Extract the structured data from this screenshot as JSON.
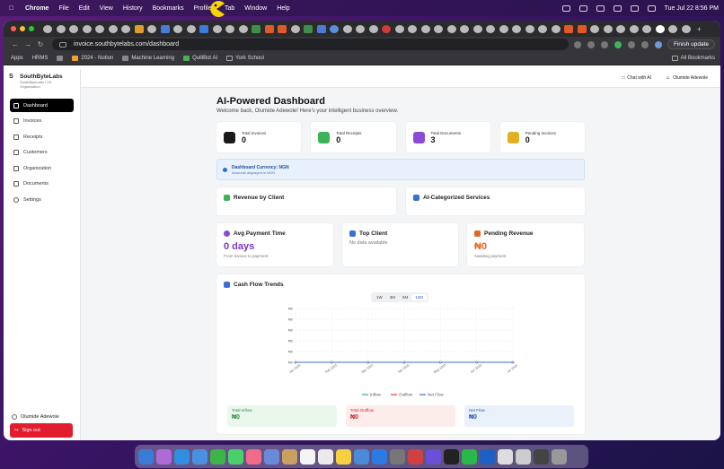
{
  "menubar": {
    "items": [
      "Chrome",
      "File",
      "Edit",
      "View",
      "History",
      "Bookmarks",
      "Profiles",
      "Tab",
      "Window",
      "Help"
    ],
    "clock": "Tue Jul 22  8:56 PM"
  },
  "browser": {
    "url": "invoice.southbytelabs.com/dashboard",
    "update_label": "Finish update",
    "bookmarks": [
      "Apps",
      "HRMS",
      "2024 - Notion",
      "Machine Learning",
      "QuillBot AI",
      "York School"
    ],
    "all_bookmarks": "All Bookmarks"
  },
  "sidebar": {
    "org_initial": "S",
    "org_name": "SouthByteLabs",
    "org_sub": "SouthByteLabs LTD",
    "org_role": "Organization",
    "items": [
      {
        "label": "Dashboard"
      },
      {
        "label": "Invoices"
      },
      {
        "label": "Receipts"
      },
      {
        "label": "Customers"
      },
      {
        "label": "Organization"
      },
      {
        "label": "Documents"
      },
      {
        "label": "Settings"
      }
    ],
    "user": "Olumide Adewole",
    "signout": "Sign out"
  },
  "topbar": {
    "chat": "Chat with AI",
    "user": "Olumide Adewole"
  },
  "dashboard": {
    "title": "AI-Powered Dashboard",
    "welcome": "Welcome back, Olumide Adewole! Here's your intelligent business overview.",
    "stats": [
      {
        "label": "Total Invoices",
        "value": "0",
        "color": "#1a1a1a"
      },
      {
        "label": "Total Receipts",
        "value": "0",
        "color": "#3cb45a"
      },
      {
        "label": "Total Documents",
        "value": "3",
        "color": "#8b4bd6"
      },
      {
        "label": "Pending Invoices",
        "value": "0",
        "color": "#e0b020"
      }
    ],
    "currency_title": "Dashboard Currency: NGN",
    "currency_sub": "Amounts displayed in NGN",
    "revenue_by_client": "Revenue by Client",
    "ai_services": "AI-Categorized Services",
    "avg_payment": {
      "title": "Avg Payment Time",
      "value": "0 days",
      "sub": "From invoice to payment"
    },
    "top_client": {
      "title": "Top Client",
      "value": "No data available"
    },
    "pending_revenue": {
      "title": "Pending Revenue",
      "value": "₦0",
      "sub": "Awaiting payment"
    },
    "cash_flow": {
      "title": "Cash Flow Trends",
      "ranges": [
        "1W",
        "3M",
        "6M",
        "12M"
      ],
      "active_range": "12M",
      "totals": [
        {
          "label": "Total Inflow",
          "value": "₦0",
          "bg": "#eaf7ec",
          "fg": "#2d8a3e"
        },
        {
          "label": "Total Outflow",
          "value": "₦0",
          "bg": "#fdecec",
          "fg": "#c62828"
        },
        {
          "label": "Net Flow",
          "value": "₦0",
          "bg": "#eaf1fb",
          "fg": "#2457b8"
        }
      ]
    }
  },
  "chart_data": {
    "type": "line",
    "categories": [
      "Jan 2025",
      "Feb 2025",
      "Mar 2025",
      "Apr 2025",
      "May 2025",
      "Jun 2025",
      "Jul 2025"
    ],
    "series": [
      {
        "name": "Inflow",
        "values": [
          0,
          0,
          0,
          0,
          0,
          0,
          0
        ],
        "color": "#3cb45a"
      },
      {
        "name": "Outflow",
        "values": [
          0,
          0,
          0,
          0,
          0,
          0,
          0
        ],
        "color": "#e53935"
      },
      {
        "name": "Net Flow",
        "values": [
          0,
          0,
          0,
          0,
          0,
          0,
          0
        ],
        "color": "#3b6fd8"
      }
    ],
    "y_ticks": [
      "₦0",
      "₦0",
      "₦0",
      "₦0",
      "₦0",
      "₦0"
    ],
    "legend_position": "bottom",
    "grid": true
  }
}
